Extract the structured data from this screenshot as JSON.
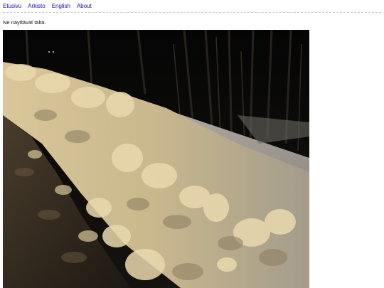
{
  "nav": {
    "items": [
      {
        "label": "Etusivu"
      },
      {
        "label": "Arkisto"
      },
      {
        "label": "English"
      },
      {
        "label": "About"
      }
    ]
  },
  "post": {
    "caption": "Ne näyttävät tältä."
  },
  "photo": {
    "subject": "snowbank-at-night"
  }
}
